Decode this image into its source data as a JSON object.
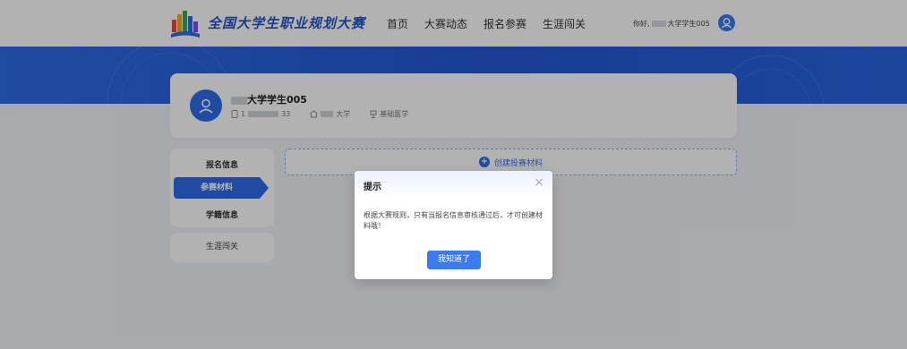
{
  "header": {
    "site_title": "全国大学生职业规划大赛",
    "nav": [
      "首页",
      "大赛动态",
      "报名参赛",
      "生涯闯关"
    ],
    "greeting_prefix": "你好,",
    "greeting_suffix": "大学学生005"
  },
  "profile": {
    "name_suffix": "大学学生005",
    "phone_prefix": "1",
    "phone_suffix": "33",
    "school_suffix": "大学",
    "major": "基础医学"
  },
  "sidebar": {
    "group": [
      "报名信息",
      "参赛材料",
      "学籍信息"
    ],
    "active_index": 1,
    "single": "生涯闯关"
  },
  "create_material_label": "创建投赛材料",
  "dialog": {
    "title": "提示",
    "message": "根据大赛规则，只有当报名信息审核通过后，才可创建材料哦！",
    "ok_label": "我知道了"
  },
  "colors": {
    "primary": "#2f6ce8",
    "title_blue": "#1f56c8"
  }
}
